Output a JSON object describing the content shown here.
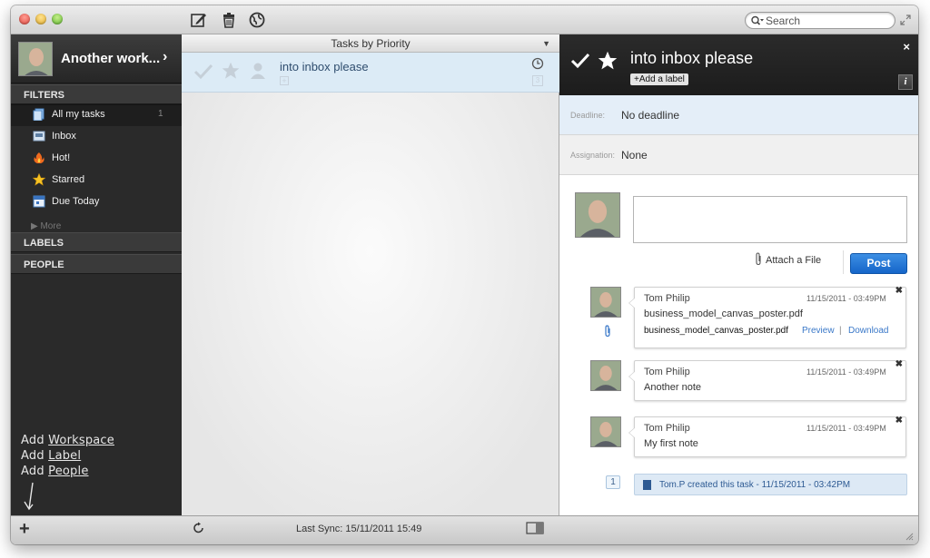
{
  "toolbar": {
    "icons": [
      "compose-icon",
      "trash-icon",
      "globe-icon"
    ],
    "search_placeholder": "Search"
  },
  "sidebar": {
    "account_name": "Another work...",
    "filters_label": "FILTERS",
    "filters": [
      {
        "label": "All my tasks",
        "count": "1",
        "icon": "all-tasks-icon",
        "selected": true
      },
      {
        "label": "Inbox",
        "icon": "inbox-icon"
      },
      {
        "label": "Hot!",
        "icon": "fire-icon"
      },
      {
        "label": "Starred",
        "icon": "star-icon"
      },
      {
        "label": "Due Today",
        "icon": "calendar-icon"
      }
    ],
    "more_label": "More",
    "labels_label": "LABELS",
    "people_label": "PEOPLE",
    "quick_add": {
      "add_word": "Add",
      "workspace": "Workspace",
      "label": "Label",
      "people": "People"
    }
  },
  "task_list": {
    "header": "Tasks by Priority",
    "tasks": [
      {
        "title": "into inbox please",
        "mini_badge": "+",
        "count_badge": "3"
      }
    ]
  },
  "detail": {
    "title": "into inbox please",
    "add_label": "+Add a label",
    "close": "×",
    "info": "i",
    "deadline_label": "Deadline:",
    "deadline_value": "No deadline",
    "assignation_label": "Assignation:",
    "assignation_value": "None",
    "attach_label": "Attach a File",
    "post_label": "Post",
    "notes": [
      {
        "author": "Tom Philip",
        "time": "11/15/2011 - 03:49PM",
        "body": "business_model_canvas_poster.pdf",
        "file": "business_model_canvas_poster.pdf",
        "preview": "Preview",
        "separator": "|",
        "download": "Download"
      },
      {
        "author": "Tom Philip",
        "time": "11/15/2011 - 03:49PM",
        "body": "Another note"
      },
      {
        "author": "Tom Philip",
        "time": "11/15/2011 - 03:49PM",
        "body": "My first note"
      }
    ],
    "history_count": "1",
    "history_text": "Tom.P created this task - 11/15/2011 - 03:42PM"
  },
  "statusbar": {
    "sync": "Last Sync: 15/11/2011 15:49"
  },
  "colors": {
    "accent": "#1565c9",
    "selection": "#dcebf6",
    "sidebar_bg": "#2a2a2a",
    "link": "#3a78c8"
  }
}
